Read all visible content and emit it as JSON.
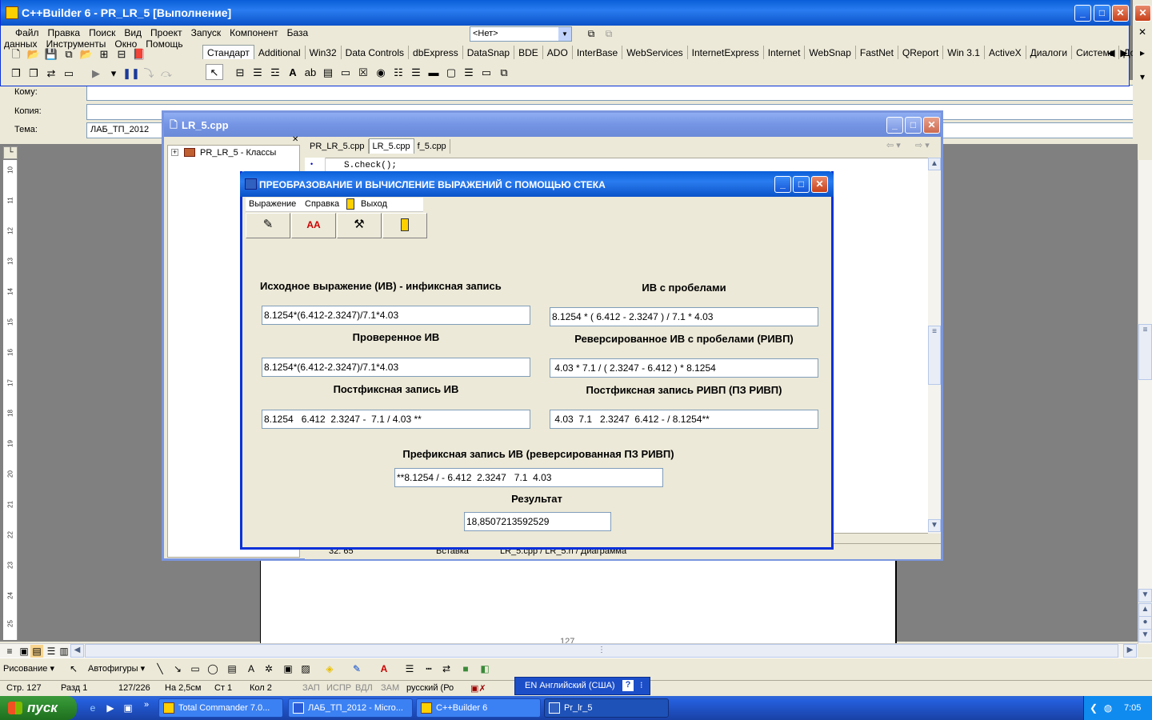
{
  "cb_main": {
    "title": "C++Builder 6 - PR_LR_5 [Выполнение]",
    "menu": [
      "Файл",
      "Правка",
      "Поиск",
      "Вид",
      "Проект",
      "Запуск",
      "Компонент",
      "База данных",
      "Инструменты",
      "Окно",
      "Помощь"
    ],
    "combo_value": "<Нет>",
    "palette_tabs": [
      "Стандарт",
      "Additional",
      "Win32",
      "Data Controls",
      "dbExpress",
      "DataSnap",
      "BDE",
      "ADO",
      "InterBase",
      "WebServices",
      "InternetExpress",
      "Internet",
      "WebSnap",
      "FastNet",
      "QReport",
      "Win 3.1",
      "ActiveX",
      "Диалоги",
      "Система",
      "Дополн"
    ]
  },
  "word_bg": {
    "to_label": "Кому:",
    "copy_label": "Копия:",
    "subject_label": "Тема:",
    "subject_value": "ЛАБ_ТП_2012",
    "page_number": "127",
    "ruler_numbers": [
      "10",
      "11",
      "12",
      "13",
      "14",
      "15",
      "16",
      "17",
      "18",
      "19",
      "20",
      "21",
      "22",
      "23",
      "24",
      "25"
    ],
    "drawbar": {
      "draw": "Рисование",
      "autoshapes": "Автофигуры"
    },
    "status": {
      "page": "Стр. 127",
      "section": "Разд 1",
      "pages": "127/226",
      "at": "На 2,5см",
      "line": "Ст 1",
      "col": "Кол 2",
      "rec": "ЗАП",
      "trk": "ИСПР",
      "ext": "ВДЛ",
      "ovr": "ЗАМ",
      "lang": "русский (Ро"
    },
    "langbar": "EN Английский (США)"
  },
  "editor": {
    "title": "LR_5.cpp",
    "class_tree_item": "PR_LR_5 - Классы",
    "tabs": [
      "PR_LR_5.cpp",
      "LR_5.cpp",
      "f_5.cpp"
    ],
    "code_line": "S.check();",
    "status_pos": "32: 65",
    "status_mode": "Вставка",
    "status_tabs": "LR_5.cpp / LR_5.h / Диаграмма"
  },
  "dialog": {
    "title": "ПРЕОБРАЗОВАНИЕ И ВЫЧИСЛЕНИЕ ВЫРАЖЕНИЙ С ПОМОЩЬЮ СТЕКА",
    "menu": {
      "expression": "Выражение",
      "help": "Справка",
      "exit": "Выход"
    },
    "fields": {
      "infix": {
        "label": "Исходное выражение (ИВ) - инфиксная запись",
        "value": "8.1254*(6.412-2.3247)/7.1*4.03"
      },
      "spaced": {
        "label": "ИВ с пробелами",
        "value": "8.1254 * ( 6.412 - 2.3247 ) / 7.1 * 4.03"
      },
      "checked": {
        "label": "Проверенное ИВ",
        "value": "8.1254*(6.412-2.3247)/7.1*4.03"
      },
      "reversed": {
        "label": "Реверсированное ИВ с пробелами (РИВП)",
        "value": " 4.03 * 7.1 / ( 2.3247 - 6.412 ) * 8.1254"
      },
      "postfix": {
        "label": "Постфиксная запись ИВ",
        "value": "8.1254   6.412  2.3247 -  7.1 / 4.03 **"
      },
      "postfix_rev": {
        "label": "Постфиксная запись РИВП (ПЗ  РИВП)",
        "value": " 4.03  7.1   2.3247  6.412 - / 8.1254**"
      },
      "prefix": {
        "label": "Префиксная запись ИВ (реверсированная ПЗ РИВП)",
        "value": "**8.1254 / - 6.412  2.3247   7.1  4.03"
      },
      "result": {
        "label": "Результат",
        "value": "18,8507213592529"
      }
    }
  },
  "taskbar": {
    "start": "пуск",
    "tasks": [
      "Total Commander 7.0...",
      "ЛАБ_ТП_2012 - Micro...",
      "C++Builder 6",
      "Pr_lr_5"
    ],
    "clock": "7:05"
  }
}
